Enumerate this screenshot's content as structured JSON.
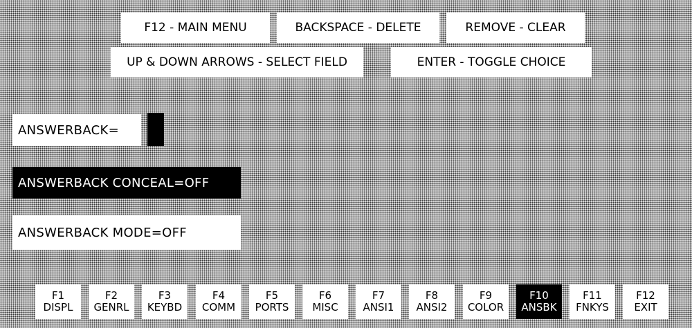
{
  "help": {
    "row1": [
      "F12 - MAIN MENU",
      "BACKSPACE - DELETE",
      "REMOVE - CLEAR"
    ],
    "row2": [
      "UP & DOWN ARROWS - SELECT FIELD",
      "ENTER - TOGGLE CHOICE"
    ]
  },
  "fields": {
    "answerback_label": "ANSWERBACK=",
    "answerback_value": "",
    "conceal": "ANSWERBACK CONCEAL=OFF",
    "mode": "ANSWERBACK MODE=OFF"
  },
  "fkeys": [
    {
      "key": "F1",
      "label": "DISPL"
    },
    {
      "key": "F2",
      "label": "GENRL"
    },
    {
      "key": "F3",
      "label": "KEYBD"
    },
    {
      "key": "F4",
      "label": "COMM"
    },
    {
      "key": "F5",
      "label": "PORTS"
    },
    {
      "key": "F6",
      "label": "MISC"
    },
    {
      "key": "F7",
      "label": "ANSI1"
    },
    {
      "key": "F8",
      "label": "ANSI2"
    },
    {
      "key": "F9",
      "label": "COLOR"
    },
    {
      "key": "F10",
      "label": "ANSBK"
    },
    {
      "key": "F11",
      "label": "FNKYS"
    },
    {
      "key": "F12",
      "label": "EXIT"
    }
  ],
  "active_fkey": "F10",
  "colors": {
    "highlight_bg": "#000000",
    "highlight_fg": "#ffffff",
    "panel_bg": "#ffffff"
  }
}
